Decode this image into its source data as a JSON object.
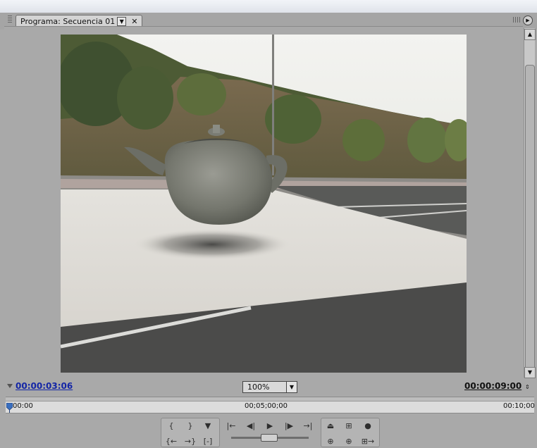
{
  "panel": {
    "tab_label": "Programa: Secuencia 01",
    "tab_menu_icon": "chevron-down-icon",
    "tab_close": "✕"
  },
  "timecode": {
    "current": "00:00:03:06",
    "duration": "00:00:09:00"
  },
  "zoom": {
    "value": "100%",
    "options_visible": [
      "100%"
    ]
  },
  "ruler": {
    "start": "00:00",
    "middle": "00;05;00;00",
    "end": "00:10;00"
  },
  "colors": {
    "timecode_link": "#1426a6",
    "panel_bg": "#a9a9a9"
  },
  "transport": {
    "buttons": [
      "mark-in-icon",
      "mark-out-icon",
      "set-marker-icon",
      "go-to-in-icon",
      "step-back-icon",
      "play-icon",
      "step-forward-icon",
      "go-to-out-icon",
      "lift-icon",
      "extract-icon",
      "export-frame-icon",
      "trim-in-icon",
      "trim-out-icon",
      "clear-icon",
      "overlay-icon",
      "insert-icon",
      "safe-margins-icon"
    ]
  }
}
